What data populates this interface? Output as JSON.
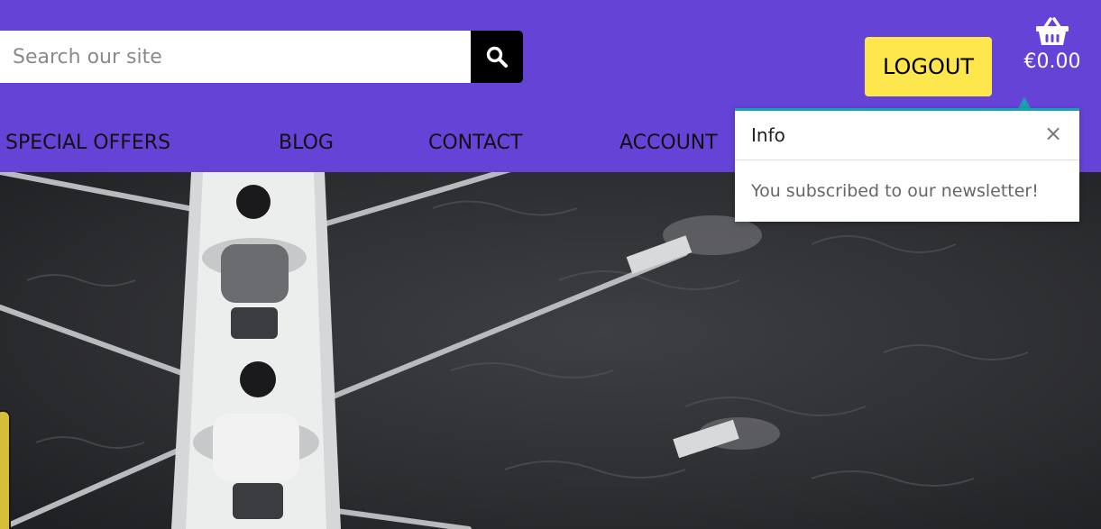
{
  "search": {
    "placeholder": "Search our site",
    "button_icon": "search-icon"
  },
  "header": {
    "logout_label": "LOGOUT",
    "cart_icon": "basket-icon",
    "cart_total": "€0.00"
  },
  "nav": {
    "items": [
      {
        "label": "SPECIAL OFFERS"
      },
      {
        "label": "BLOG"
      },
      {
        "label": "CONTACT"
      },
      {
        "label": "ACCOUNT"
      }
    ]
  },
  "toast": {
    "title": "Info",
    "close_symbol": "×",
    "message": "You subscribed to our newsletter!"
  },
  "colors": {
    "header_bg": "#6543d6",
    "logout_bg": "#fde74c",
    "toast_accent": "#17a2b8"
  }
}
